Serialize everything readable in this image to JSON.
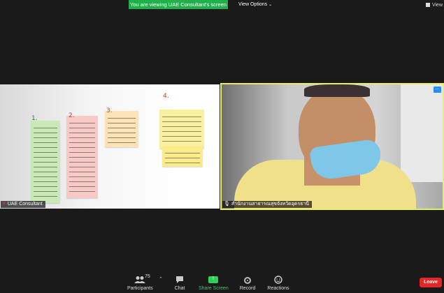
{
  "banner": {
    "text": "You are viewing UAE Consultant's screen"
  },
  "view_options": {
    "label": "View Options",
    "chevron": "chevron-down-icon"
  },
  "view_button": {
    "label": "View",
    "icon": "grid-view-icon"
  },
  "tiles": [
    {
      "name": "UAE Consultant",
      "mic_muted": true,
      "labels": [
        "1.",
        "2.",
        "3.",
        "4."
      ]
    },
    {
      "name": "สำนักงานสาธารณสุขจังหวัดอุดรธานี",
      "active_speaker": true,
      "more_label": "..."
    }
  ],
  "toolbar": {
    "participants": {
      "label": "Participants",
      "count": "75",
      "icon": "participants-icon"
    },
    "chat": {
      "label": "Chat",
      "icon": "chat-icon"
    },
    "share": {
      "label": "Share Screen",
      "icon": "share-screen-icon"
    },
    "record": {
      "label": "Record",
      "icon": "record-icon"
    },
    "reactions": {
      "label": "Reactions",
      "icon": "reactions-icon"
    },
    "leave": {
      "label": "Leave"
    }
  },
  "colors": {
    "accent_green": "#21b14b",
    "active_border": "#e7f05b",
    "leave_red": "#e02828",
    "share_green": "#2fcf5b"
  }
}
